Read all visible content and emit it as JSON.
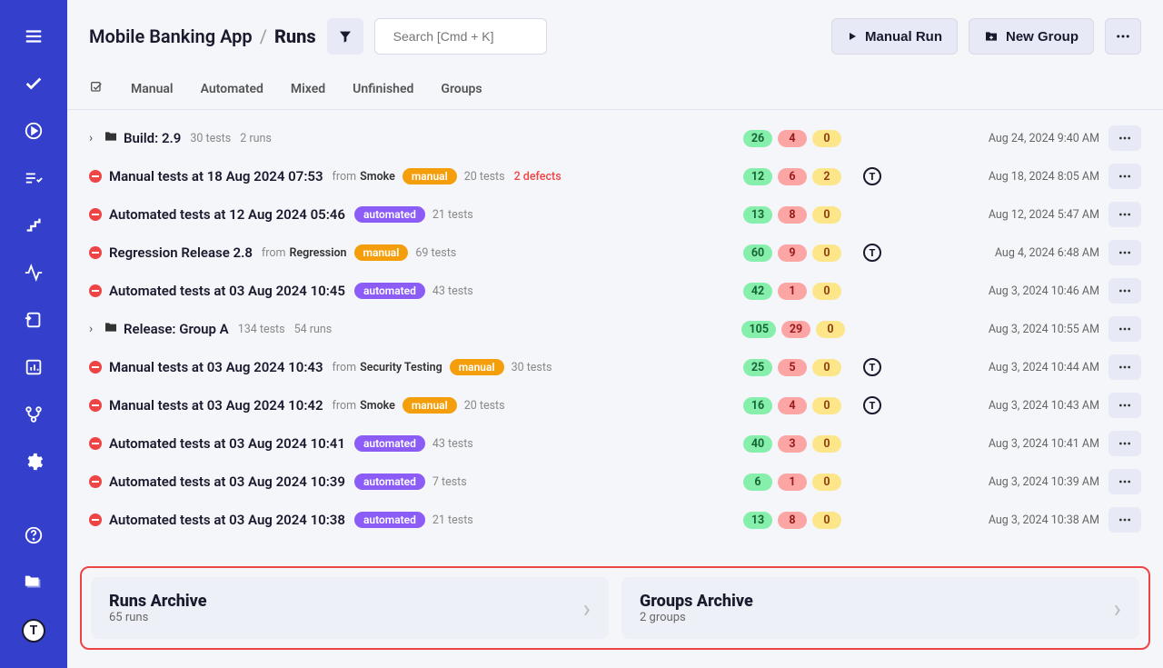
{
  "breadcrumb": {
    "project": "Mobile Banking App",
    "sep": "/",
    "page": "Runs"
  },
  "search": {
    "placeholder": "Search [Cmd + K]"
  },
  "buttons": {
    "manual_run": "Manual Run",
    "new_group": "New Group"
  },
  "tabs": [
    "Manual",
    "Automated",
    "Mixed",
    "Unfinished",
    "Groups"
  ],
  "rows": [
    {
      "type": "group",
      "title": "Build: 2.9",
      "sub1": "30 tests",
      "sub2": "2 runs",
      "g": "26",
      "r": "4",
      "y": "0",
      "date": "Aug 24, 2024 9:40 AM"
    },
    {
      "type": "run-manual",
      "title": "Manual tests at 18 Aug 2024 07:53",
      "from": "Smoke",
      "pill": "manual",
      "sub1": "20 tests",
      "defects": "2 defects",
      "g": "12",
      "r": "6",
      "y": "2",
      "user": "T",
      "date": "Aug 18, 2024 8:05 AM"
    },
    {
      "type": "run-auto",
      "title": "Automated tests at 12 Aug 2024 05:46",
      "pill": "automated",
      "sub1": "21 tests",
      "g": "13",
      "r": "8",
      "y": "0",
      "date": "Aug 12, 2024 5:47 AM"
    },
    {
      "type": "run-manual",
      "title": "Regression Release 2.8",
      "from": "Regression",
      "pill": "manual",
      "sub1": "69 tests",
      "g": "60",
      "r": "9",
      "y": "0",
      "user": "T",
      "date": "Aug 4, 2024 6:48 AM"
    },
    {
      "type": "run-auto",
      "title": "Automated tests at 03 Aug 2024 10:45",
      "pill": "automated",
      "sub1": "43 tests",
      "g": "42",
      "r": "1",
      "y": "0",
      "date": "Aug 3, 2024 10:46 AM"
    },
    {
      "type": "group",
      "title": "Release: Group A",
      "sub1": "134 tests",
      "sub2": "54 runs",
      "g": "105",
      "r": "29",
      "y": "0",
      "date": "Aug 3, 2024 10:55 AM"
    },
    {
      "type": "run-manual",
      "title": "Manual tests at 03 Aug 2024 10:43",
      "from": "Security Testing",
      "pill": "manual",
      "sub1": "30 tests",
      "g": "25",
      "r": "5",
      "y": "0",
      "user": "T",
      "date": "Aug 3, 2024 10:44 AM"
    },
    {
      "type": "run-manual",
      "title": "Manual tests at 03 Aug 2024 10:42",
      "from": "Smoke",
      "pill": "manual",
      "sub1": "20 tests",
      "g": "16",
      "r": "4",
      "y": "0",
      "user": "T",
      "date": "Aug 3, 2024 10:43 AM"
    },
    {
      "type": "run-auto",
      "title": "Automated tests at 03 Aug 2024 10:41",
      "pill": "automated",
      "sub1": "43 tests",
      "g": "40",
      "r": "3",
      "y": "0",
      "date": "Aug 3, 2024 10:41 AM"
    },
    {
      "type": "run-auto",
      "title": "Automated tests at 03 Aug 2024 10:39",
      "pill": "automated",
      "sub1": "7 tests",
      "g": "6",
      "r": "1",
      "y": "0",
      "date": "Aug 3, 2024 10:39 AM"
    },
    {
      "type": "run-auto",
      "title": "Automated tests at 03 Aug 2024 10:38",
      "pill": "automated",
      "sub1": "21 tests",
      "g": "13",
      "r": "8",
      "y": "0",
      "date": "Aug 3, 2024 10:38 AM"
    }
  ],
  "from_label": "from",
  "archive": {
    "runs": {
      "title": "Runs Archive",
      "subtitle": "65 runs"
    },
    "groups": {
      "title": "Groups Archive",
      "subtitle": "2 groups"
    }
  },
  "logo": "T"
}
